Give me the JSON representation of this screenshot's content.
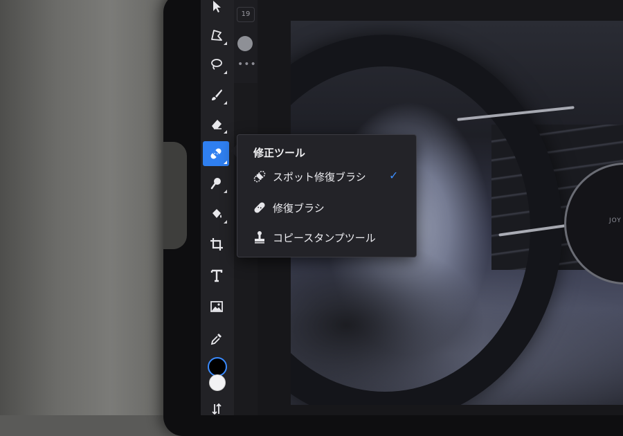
{
  "toolbar": {
    "tools": [
      {
        "name": "move-tool",
        "icon": "arrow-pointer-icon",
        "active": false
      },
      {
        "name": "polygon-select-tool",
        "icon": "polygon-lasso-icon",
        "active": false
      },
      {
        "name": "lasso-tool",
        "icon": "lasso-icon",
        "active": false
      },
      {
        "name": "brush-tool",
        "icon": "brush-icon",
        "active": false
      },
      {
        "name": "eraser-tool",
        "icon": "eraser-icon",
        "active": false
      },
      {
        "name": "healing-tool",
        "icon": "bandage-icon",
        "active": true
      },
      {
        "name": "clone-tool",
        "icon": "magnifier-icon",
        "active": false
      },
      {
        "name": "fill-tool",
        "icon": "paint-bucket-icon",
        "active": false
      },
      {
        "name": "crop-tool",
        "icon": "crop-icon",
        "active": false
      },
      {
        "name": "type-tool",
        "icon": "type-icon",
        "active": false
      },
      {
        "name": "place-image-tool",
        "icon": "image-icon",
        "active": false
      },
      {
        "name": "eyedropper-tool",
        "icon": "eyedropper-icon",
        "active": false
      }
    ],
    "foreground_color": "#000000",
    "background_color": "#f2f2f4",
    "accent_color": "#2f7ff0"
  },
  "options": {
    "brush_size": "19",
    "more_label": "•••"
  },
  "popup": {
    "title": "修正ツール",
    "items": [
      {
        "label": "スポット修復ブラシ",
        "icon": "spot-healing-icon",
        "selected": true
      },
      {
        "label": "修復ブラシ",
        "icon": "healing-brush-icon",
        "selected": false
      },
      {
        "label": "コピースタンプツール",
        "icon": "clone-stamp-icon",
        "selected": false
      }
    ],
    "check_mark": "✓"
  },
  "canvas": {
    "photo_text": "JOY"
  }
}
